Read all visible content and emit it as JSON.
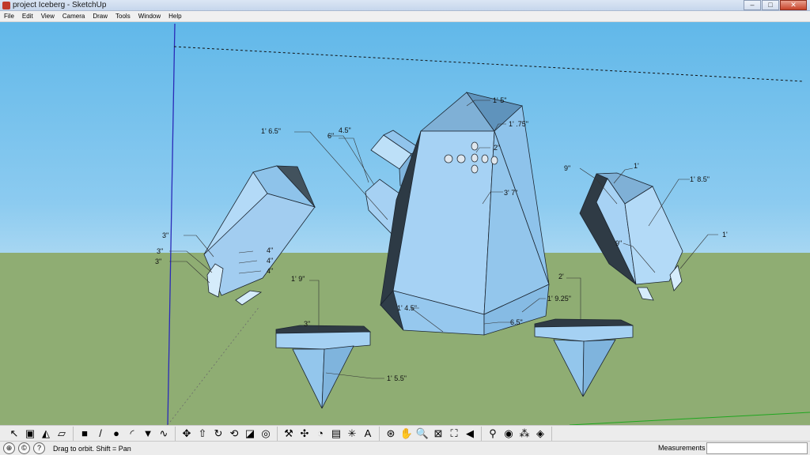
{
  "window": {
    "title": "project Iceberg - SketchUp",
    "minimize": "–",
    "maximize": "□",
    "close": "✕"
  },
  "menu": [
    "File",
    "Edit",
    "View",
    "Camera",
    "Draw",
    "Tools",
    "Window",
    "Help"
  ],
  "dimensions": {
    "top_tip": "1' 5\"",
    "top_edge": "1' .75\"",
    "body_height": "3' 7\"",
    "small_circle": "2\"",
    "left_arm_edge": "1' 6.5\"",
    "arm_length": "4.5\"",
    "arm_width": "6\"",
    "base_left": "1' 4.5\"",
    "base_right": "1' 9.25\"",
    "base_bottom": "6.5\"",
    "left_fist_a": "3\"",
    "left_fist_b": "3\"",
    "left_fist_c": "3\"",
    "left_knuckle_1": "4\"",
    "left_knuckle_2": "4\"",
    "left_knuckle_3": "4\"",
    "right_top": "1'",
    "right_side": "9\"",
    "right_length": "1' 8.5\"",
    "right_inner": "9\"",
    "right_thumb": "1'",
    "left_foot_height": "1' 9\"",
    "left_foot_top": "3\"",
    "left_foot_cone": "1' 5.5\"",
    "right_foot_height": "2'"
  },
  "toolbar": {
    "groups": [
      [
        "select-icon",
        "make-component-icon",
        "paint-bucket-icon",
        "eraser-icon"
      ],
      [
        "rectangle-icon",
        "line-icon",
        "circle-icon",
        "arc-icon",
        "polygon-icon",
        "freehand-icon"
      ],
      [
        "move-icon",
        "push-pull-icon",
        "rotate-icon",
        "follow-me-icon",
        "scale-icon",
        "offset-icon"
      ],
      [
        "tape-measure-icon",
        "dimension-icon",
        "protractor-icon",
        "text-icon",
        "axes-icon",
        "3d-text-icon"
      ],
      [
        "orbit-icon",
        "pan-icon",
        "zoom-icon",
        "zoom-window-icon",
        "zoom-extents-icon",
        "previous-view-icon"
      ],
      [
        "position-camera-icon",
        "look-around-icon",
        "walk-icon",
        "section-plane-icon"
      ]
    ],
    "glyphs": [
      [
        "↖",
        "▣",
        "◭",
        "▱"
      ],
      [
        "■",
        "/",
        "●",
        "◜",
        "▼",
        "∿"
      ],
      [
        "✥",
        "⇧",
        "↻",
        "⟲",
        "◪",
        "◎"
      ],
      [
        "⚒",
        "✣",
        "◔",
        "▤",
        "✳",
        "A"
      ],
      [
        "⊛",
        "✋",
        "🔍",
        "⊠",
        "⛶",
        "◀"
      ],
      [
        "⚲",
        "◉",
        "⁂",
        "◈"
      ]
    ]
  },
  "status": {
    "message": "Drag to orbit.  Shift = Pan",
    "measurements_label": "Measurements",
    "measurements_value": ""
  },
  "colors": {
    "sky": "#61b8e9",
    "ground": "#8fad73",
    "ice_light": "#a9d4f5",
    "ice_mid": "#8fc2ea",
    "ice_dark": "#3d4f5c"
  }
}
